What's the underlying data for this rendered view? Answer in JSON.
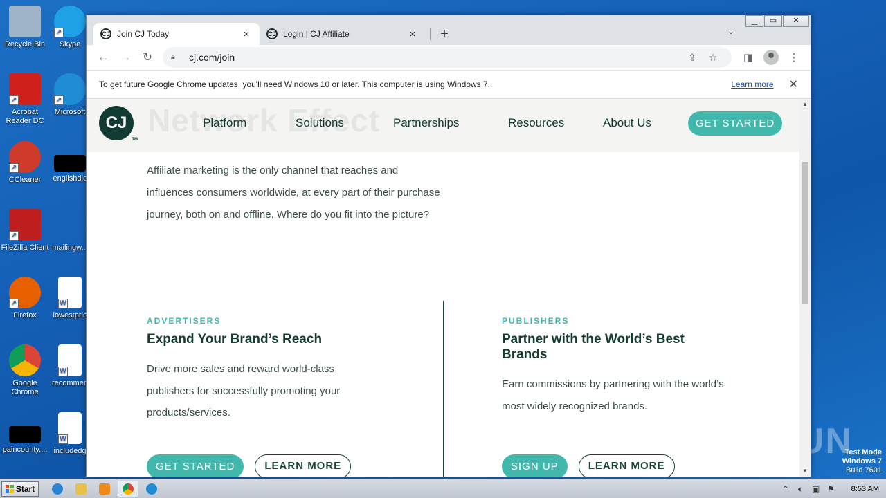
{
  "desktop": {
    "icons": [
      {
        "label": "Recycle Bin",
        "color": "#9fb4c9"
      },
      {
        "label": "Skype",
        "color": "#1ea1e6"
      },
      {
        "label": "Acrobat Reader DC",
        "color": "#d0201c"
      },
      {
        "label": "Microsoft",
        "color": "#1f8dd6"
      },
      {
        "label": "CCleaner",
        "color": "#cf3b2a"
      },
      {
        "label": "englishdic",
        "color": "#000000"
      },
      {
        "label": "FileZilla Client",
        "color": "#bf1e1e"
      },
      {
        "label": "mailingw...",
        "color": "#1560b8"
      },
      {
        "label": "Firefox",
        "color": "#e66000"
      },
      {
        "label": "lowestpric",
        "color": "#ffffff"
      },
      {
        "label": "Google Chrome",
        "color": "#db4437"
      },
      {
        "label": "recommen",
        "color": "#ffffff"
      },
      {
        "label": "paincounty....",
        "color": "#000000"
      },
      {
        "label": "includedg",
        "color": "#ffffff"
      }
    ],
    "watermark": "ANY RUN",
    "test_mode": {
      "line1": "Test Mode",
      "line2": "Windows 7",
      "line3": "Build 7601"
    }
  },
  "taskbar": {
    "start_label": "Start",
    "clock": "8:53 AM"
  },
  "browser": {
    "tabs": [
      {
        "title": "Join CJ Today",
        "favicon": "CJ",
        "active": true
      },
      {
        "title": "Login | CJ Affiliate",
        "favicon": "CJ",
        "active": false
      }
    ],
    "url": "cj.com/join",
    "infobar": {
      "message": "To get future Google Chrome updates, you'll need Windows 10 or later. This computer is using Windows 7.",
      "link": "Learn more"
    }
  },
  "page": {
    "logo_text": "CJ",
    "logo_tm": "TM",
    "ghost_heading": "Network Effect",
    "nav": [
      "Platform",
      "Solutions",
      "Partnerships",
      "Resources",
      "About Us"
    ],
    "header_cta": "GET STARTED",
    "intro": "Affiliate marketing is the only channel that reaches and influences consumers worldwide, at every part of their purchase journey, both on and offline. Where do you fit into the picture?",
    "advertisers": {
      "eyebrow": "ADVERTISERS",
      "heading": "Expand Your Brand’s Reach",
      "body": "Drive more sales and reward world-class publishers for successfully promoting your products/services.",
      "primary": "GET STARTED",
      "secondary": "LEARN MORE"
    },
    "publishers": {
      "eyebrow": "PUBLISHERS",
      "heading": "Partner with the World’s Best Brands",
      "body": "Earn commissions by partnering with the world’s most widely recognized brands.",
      "primary": "SIGN UP",
      "secondary": "LEARN MORE"
    }
  },
  "colors": {
    "brand_dark": "#123c33",
    "brand_teal": "#42b8ad"
  }
}
